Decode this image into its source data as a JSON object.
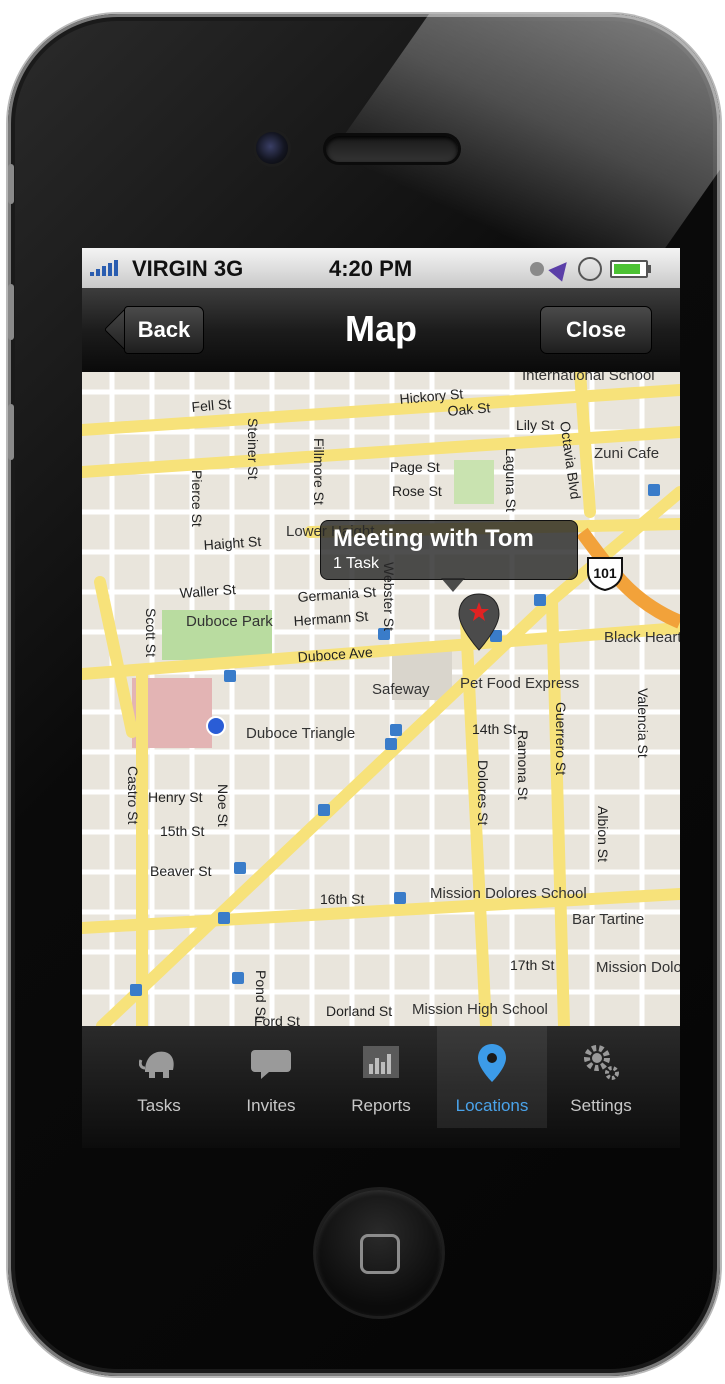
{
  "status_bar": {
    "carrier": "VIRGIN 3G",
    "time": "4:20 PM",
    "icons": [
      "signal-icon",
      "alarm-icon",
      "location-arrow-icon",
      "rotation-lock-icon",
      "battery-icon"
    ]
  },
  "nav": {
    "title": "Map",
    "back_label": "Back",
    "close_label": "Close"
  },
  "callout": {
    "title": "Meeting with Tom",
    "subtitle": "1 Task"
  },
  "map": {
    "streets": [
      "Fell St",
      "Hickory St",
      "Oak St",
      "Lily St",
      "Octavia Blvd",
      "Page St",
      "Rose St",
      "Haight St",
      "Waller St",
      "Germania St",
      "Hermann St",
      "Duboce Ave",
      "14th St",
      "15th St",
      "16th St",
      "17th St",
      "Henry St",
      "Beaver St",
      "Pond St",
      "Dorland St",
      "Ford St",
      "Scott St",
      "Pierce St",
      "Steiner St",
      "Fillmore St",
      "Webster St",
      "Laguna St",
      "Castro St",
      "Noe St",
      "Dolores St",
      "Ramona St",
      "Guerrero St",
      "Albion St",
      "Valencia St"
    ],
    "places": [
      "International School",
      "Zuni Cafe",
      "Lower Haight",
      "Duboce Park",
      "Safeway",
      "Pet Food Express",
      "Duboce Triangle",
      "Mission Dolores School",
      "Bar Tartine",
      "Mission High School",
      "Mission Dolores",
      "Black Heart Tattoo"
    ],
    "highway_shield": "101",
    "colors": {
      "road": "#f7e27a",
      "minor_road": "#ffffff",
      "park": "#b9dca0",
      "hospital": "#e3b4b4",
      "land": "#e9e5dc",
      "pin": "#4b4b4b",
      "pin_star": "#e02222",
      "you_are_here": "#2a5dd6"
    }
  },
  "tabs": [
    {
      "label": "Tasks",
      "icon": "elephant-icon",
      "active": false
    },
    {
      "label": "Invites",
      "icon": "chat-bubble-icon",
      "active": false
    },
    {
      "label": "Reports",
      "icon": "bar-chart-icon",
      "active": false
    },
    {
      "label": "Locations",
      "icon": "map-pin-icon",
      "active": true
    },
    {
      "label": "Settings",
      "icon": "gears-icon",
      "active": false
    }
  ]
}
